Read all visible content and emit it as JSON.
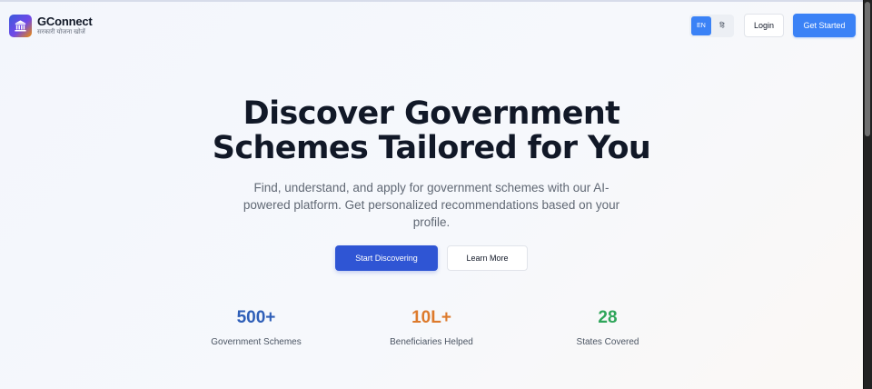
{
  "header": {
    "brand_name": "GConnect",
    "brand_tagline": "सरकारी योजना खोजें",
    "lang_en": "EN",
    "lang_hi": "हि",
    "login_label": "Login",
    "get_started_label": "Get Started"
  },
  "hero": {
    "title_line1": "Discover Government",
    "title_line2": "Schemes Tailored for You",
    "subtitle_line1": "Find, understand, and apply for government schemes with our AI-",
    "subtitle_line2": "powered platform. Get personalized recommendations based on your",
    "subtitle_line3": "profile.",
    "primary_cta": "Start Discovering",
    "secondary_cta": "Learn More"
  },
  "stats": [
    {
      "value": "500+",
      "label": "Government Schemes",
      "color": "#2f5fb8"
    },
    {
      "value": "10L+",
      "label": "Beneficiaries Helped",
      "color": "#dd7a2c"
    },
    {
      "value": "28",
      "label": "States Covered",
      "color": "#2fa55a"
    }
  ],
  "colors": {
    "accent": "#3b82f6",
    "primary_button": "#2f55d4"
  },
  "icons": {
    "logo": "government-building-icon"
  }
}
